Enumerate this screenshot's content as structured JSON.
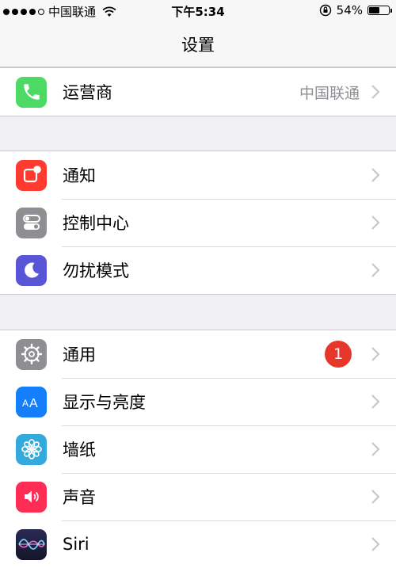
{
  "status_bar": {
    "carrier": "中国联通",
    "time": "下午5:34",
    "battery": "54%",
    "battery_level": 0.54
  },
  "nav": {
    "title": "设置"
  },
  "groups": [
    {
      "items": [
        {
          "label": "运营商",
          "value": "中国联通",
          "icon": "phone-icon",
          "color": "#4cd964"
        }
      ]
    },
    {
      "items": [
        {
          "label": "通知",
          "icon": "notifications-icon",
          "color": "#ff3b30"
        },
        {
          "label": "控制中心",
          "icon": "control-center-icon",
          "color": "#8e8e93"
        },
        {
          "label": "勿扰模式",
          "icon": "moon-icon",
          "color": "#5856d6"
        }
      ]
    },
    {
      "items": [
        {
          "label": "通用",
          "badge": "1",
          "icon": "gear-icon",
          "color": "#8e8e93"
        },
        {
          "label": "显示与亮度",
          "icon": "display-brightness-icon",
          "color": "#147efb"
        },
        {
          "label": "墙纸",
          "icon": "wallpaper-icon",
          "color": "#34aadc"
        },
        {
          "label": "声音",
          "icon": "sound-icon",
          "color": "#ff2d55"
        },
        {
          "label": "Siri",
          "icon": "siri-icon",
          "color": "#1c1c3a"
        }
      ]
    }
  ]
}
